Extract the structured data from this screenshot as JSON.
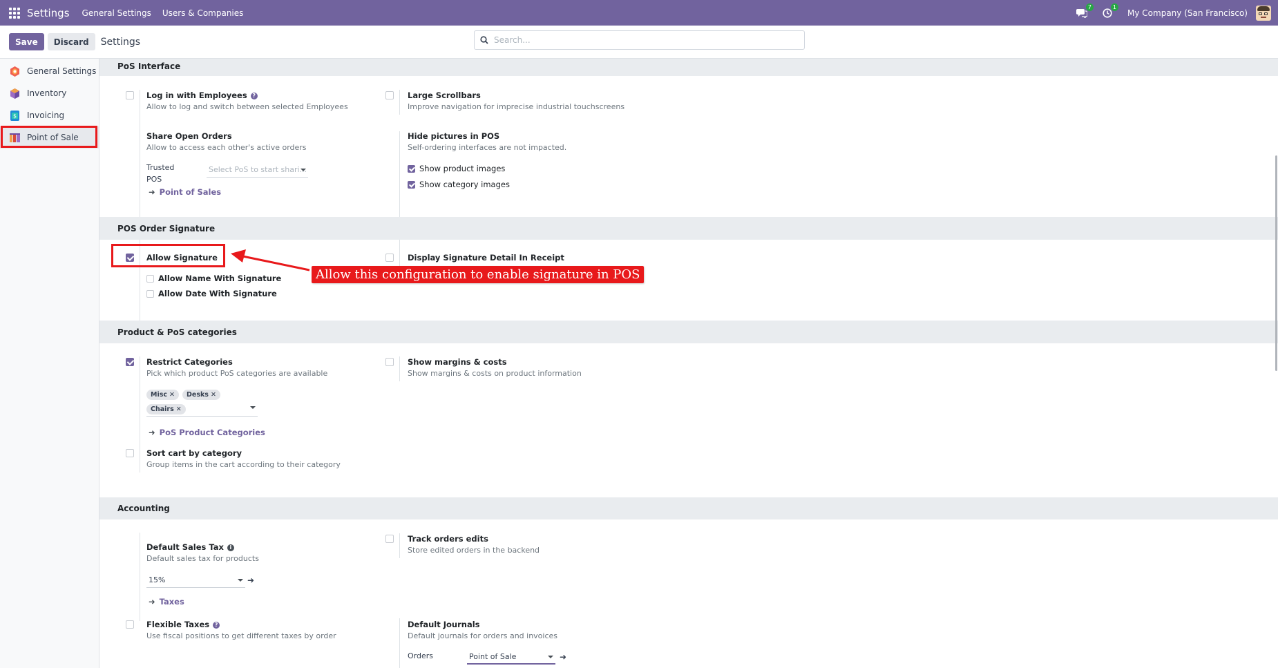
{
  "navbar": {
    "app_title": "Settings",
    "menus": [
      "General Settings",
      "Users & Companies"
    ],
    "messages_badge": "7",
    "activities_badge": "1",
    "company": "My Company (San Francisco)"
  },
  "control_panel": {
    "save_label": "Save",
    "discard_label": "Discard",
    "title": "Settings",
    "search_placeholder": "Search..."
  },
  "sidebar": {
    "items": [
      {
        "label": "General Settings",
        "icon": "odoo-settings-icon",
        "color": "#f06050"
      },
      {
        "label": "Inventory",
        "icon": "inventory-icon",
        "color": "#9d6cc4"
      },
      {
        "label": "Invoicing",
        "icon": "invoicing-icon",
        "color": "#1f8ad6"
      },
      {
        "label": "Point of Sale",
        "icon": "point-of-sale-icon",
        "color": "#d84a3a",
        "active": true
      }
    ]
  },
  "sections": {
    "pos_interface": {
      "title": "PoS Interface",
      "login_employees": {
        "title": "Log in with Employees",
        "desc": "Allow to log and switch between selected Employees",
        "checked": false
      },
      "large_scrollbars": {
        "title": "Large Scrollbars",
        "desc": "Improve navigation for imprecise industrial touchscreens",
        "checked": false
      },
      "share_orders": {
        "title": "Share Open Orders",
        "desc": "Allow to access each other's active orders",
        "trusted_label_1": "Trusted",
        "trusted_label_2": "POS",
        "trusted_placeholder": "Select PoS to start shari...",
        "link": "Point of Sales"
      },
      "hide_pictures": {
        "title": "Hide pictures in POS",
        "desc": "Self-ordering interfaces are not impacted.",
        "show_product": "Show product images",
        "show_category": "Show category images"
      }
    },
    "signature": {
      "title": "POS Order Signature",
      "allow_signature": {
        "title": "Allow Signature",
        "checked": true
      },
      "allow_name": "Allow Name With Signature",
      "allow_date": "Allow Date With Signature",
      "display_detail": {
        "title": "Display Signature Detail In Receipt",
        "checked": false
      }
    },
    "categories": {
      "title": "Product & PoS categories",
      "restrict": {
        "title": "Restrict Categories",
        "desc": "Pick which product PoS categories are available",
        "tags": [
          "Misc",
          "Desks",
          "Chairs"
        ],
        "link": "PoS Product Categories",
        "checked": true
      },
      "margins": {
        "title": "Show margins & costs",
        "desc": "Show margins & costs on product information",
        "checked": false
      },
      "sort_cart": {
        "title": "Sort cart by category",
        "desc": "Group items in the cart according to their category",
        "checked": false
      }
    },
    "accounting": {
      "title": "Accounting",
      "default_tax": {
        "title": "Default Sales Tax",
        "desc": "Default sales tax for products",
        "value": "15%",
        "link": "Taxes"
      },
      "track_edits": {
        "title": "Track orders edits",
        "desc": "Store edited orders in the backend",
        "checked": false
      },
      "flexible_taxes": {
        "title": "Flexible Taxes",
        "desc": "Use fiscal positions to get different taxes by order",
        "checked": false
      },
      "default_journals": {
        "title": "Default Journals",
        "desc": "Default journals for orders and invoices",
        "orders_label": "Orders",
        "orders_value": "Point of Sale"
      }
    }
  },
  "annotation": {
    "callout": "Allow this configuration to enable signature in POS",
    "color": "#e8191b"
  }
}
